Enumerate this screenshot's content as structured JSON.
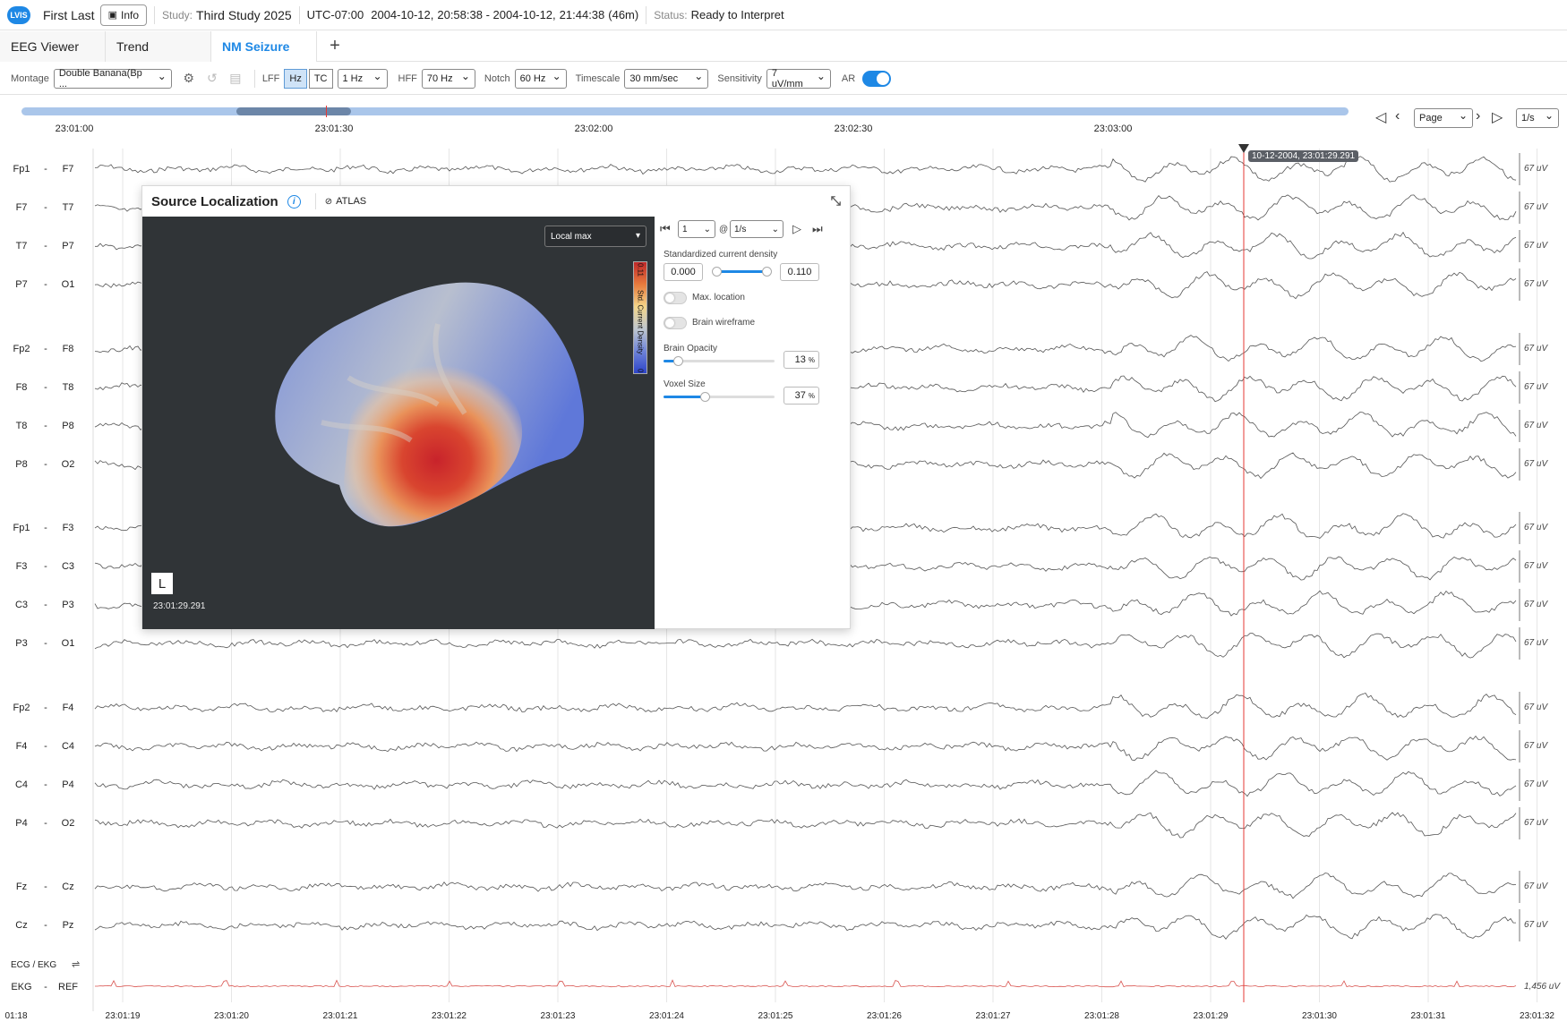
{
  "header": {
    "logo": "LVIS",
    "user": "First Last",
    "info_label": "Info",
    "study_label": "Study:",
    "study_name": "Third Study 2025",
    "timezone": "UTC-07:00",
    "range_start_date": "2004-10-12,",
    "range_start_time": "20:58:38",
    "range_dash": " - ",
    "range_end_date": "2004-10-12,",
    "range_end_time": "21:44:38",
    "range_duration": "(46m)",
    "status_label": "Status:",
    "status_value": "Ready to Interpret"
  },
  "tabs": [
    {
      "label": "EEG Viewer"
    },
    {
      "label": "Trend"
    },
    {
      "label": "NM Seizure"
    }
  ],
  "toolbar": {
    "montage_label": "Montage",
    "montage_value": "Double Banana(Bp ...",
    "lff_label": "LFF",
    "hz_label": "Hz",
    "tc_label": "TC",
    "lff_value": "1 Hz",
    "hff_label": "HFF",
    "hff_value": "70 Hz",
    "notch_label": "Notch",
    "notch_value": "60 Hz",
    "timescale_label": "Timescale",
    "timescale_value": "30 mm/sec",
    "sensitivity_label": "Sensitivity",
    "sensitivity_value": "7 uV/mm",
    "ar_label": "AR",
    "ar_on": true
  },
  "timeline": {
    "labels": [
      "23:01:00",
      "23:01:30",
      "23:02:00",
      "23:02:30",
      "23:03:00"
    ],
    "page_value": "Page",
    "rate_value": "1/s"
  },
  "cursor": {
    "label": "10-12-2004, 23:01:29.291"
  },
  "channels": [
    {
      "a": "Fp1",
      "b": "F7"
    },
    {
      "a": "F7",
      "b": "T7"
    },
    {
      "a": "T7",
      "b": "P7"
    },
    {
      "a": "P7",
      "b": "O1"
    },
    {
      "a": "Fp2",
      "b": "F8"
    },
    {
      "a": "F8",
      "b": "T8"
    },
    {
      "a": "T8",
      "b": "P8"
    },
    {
      "a": "P8",
      "b": "O2"
    },
    {
      "a": "Fp1",
      "b": "F3"
    },
    {
      "a": "F3",
      "b": "C3"
    },
    {
      "a": "C3",
      "b": "P3"
    },
    {
      "a": "P3",
      "b": "O1"
    },
    {
      "a": "Fp2",
      "b": "F4"
    },
    {
      "a": "F4",
      "b": "C4"
    },
    {
      "a": "C4",
      "b": "P4"
    },
    {
      "a": "P4",
      "b": "O2"
    },
    {
      "a": "Fz",
      "b": "Cz"
    },
    {
      "a": "Cz",
      "b": "Pz"
    }
  ],
  "channel_dash": "-",
  "channel_scale": "67 uV",
  "ecg_section_label": "ECG / EKG",
  "ekg_channel": {
    "a": "EKG",
    "b": "REF",
    "scale": "1,456 uV"
  },
  "bottom_ticks": [
    "01:18",
    "23:01:19",
    "23:01:20",
    "23:01:21",
    "23:01:22",
    "23:01:23",
    "23:01:24",
    "23:01:25",
    "23:01:26",
    "23:01:27",
    "23:01:28",
    "23:01:29",
    "23:01:30",
    "23:01:31",
    "23:01:32"
  ],
  "source_panel": {
    "title": "Source Localization",
    "atlas_label": "ATLAS",
    "mode_value": "Local max",
    "colorbar_max": "0.11",
    "colorbar_title": "Std. Current Density",
    "colorbar_min": "0",
    "side_label": "L",
    "timestamp": "23:01:29.291",
    "frame_value": "1",
    "at_symbol": "@",
    "rate_value": "1/s",
    "density_label": "Standardized current density",
    "density_min": "0.000",
    "density_max": "0.110",
    "max_location_label": "Max. location",
    "max_location_on": false,
    "wireframe_label": "Brain wireframe",
    "wireframe_on": false,
    "opacity_label": "Brain Opacity",
    "opacity_value": "13",
    "opacity_unit": "%",
    "voxel_label": "Voxel Size",
    "voxel_value": "37",
    "voxel_unit": "%"
  }
}
